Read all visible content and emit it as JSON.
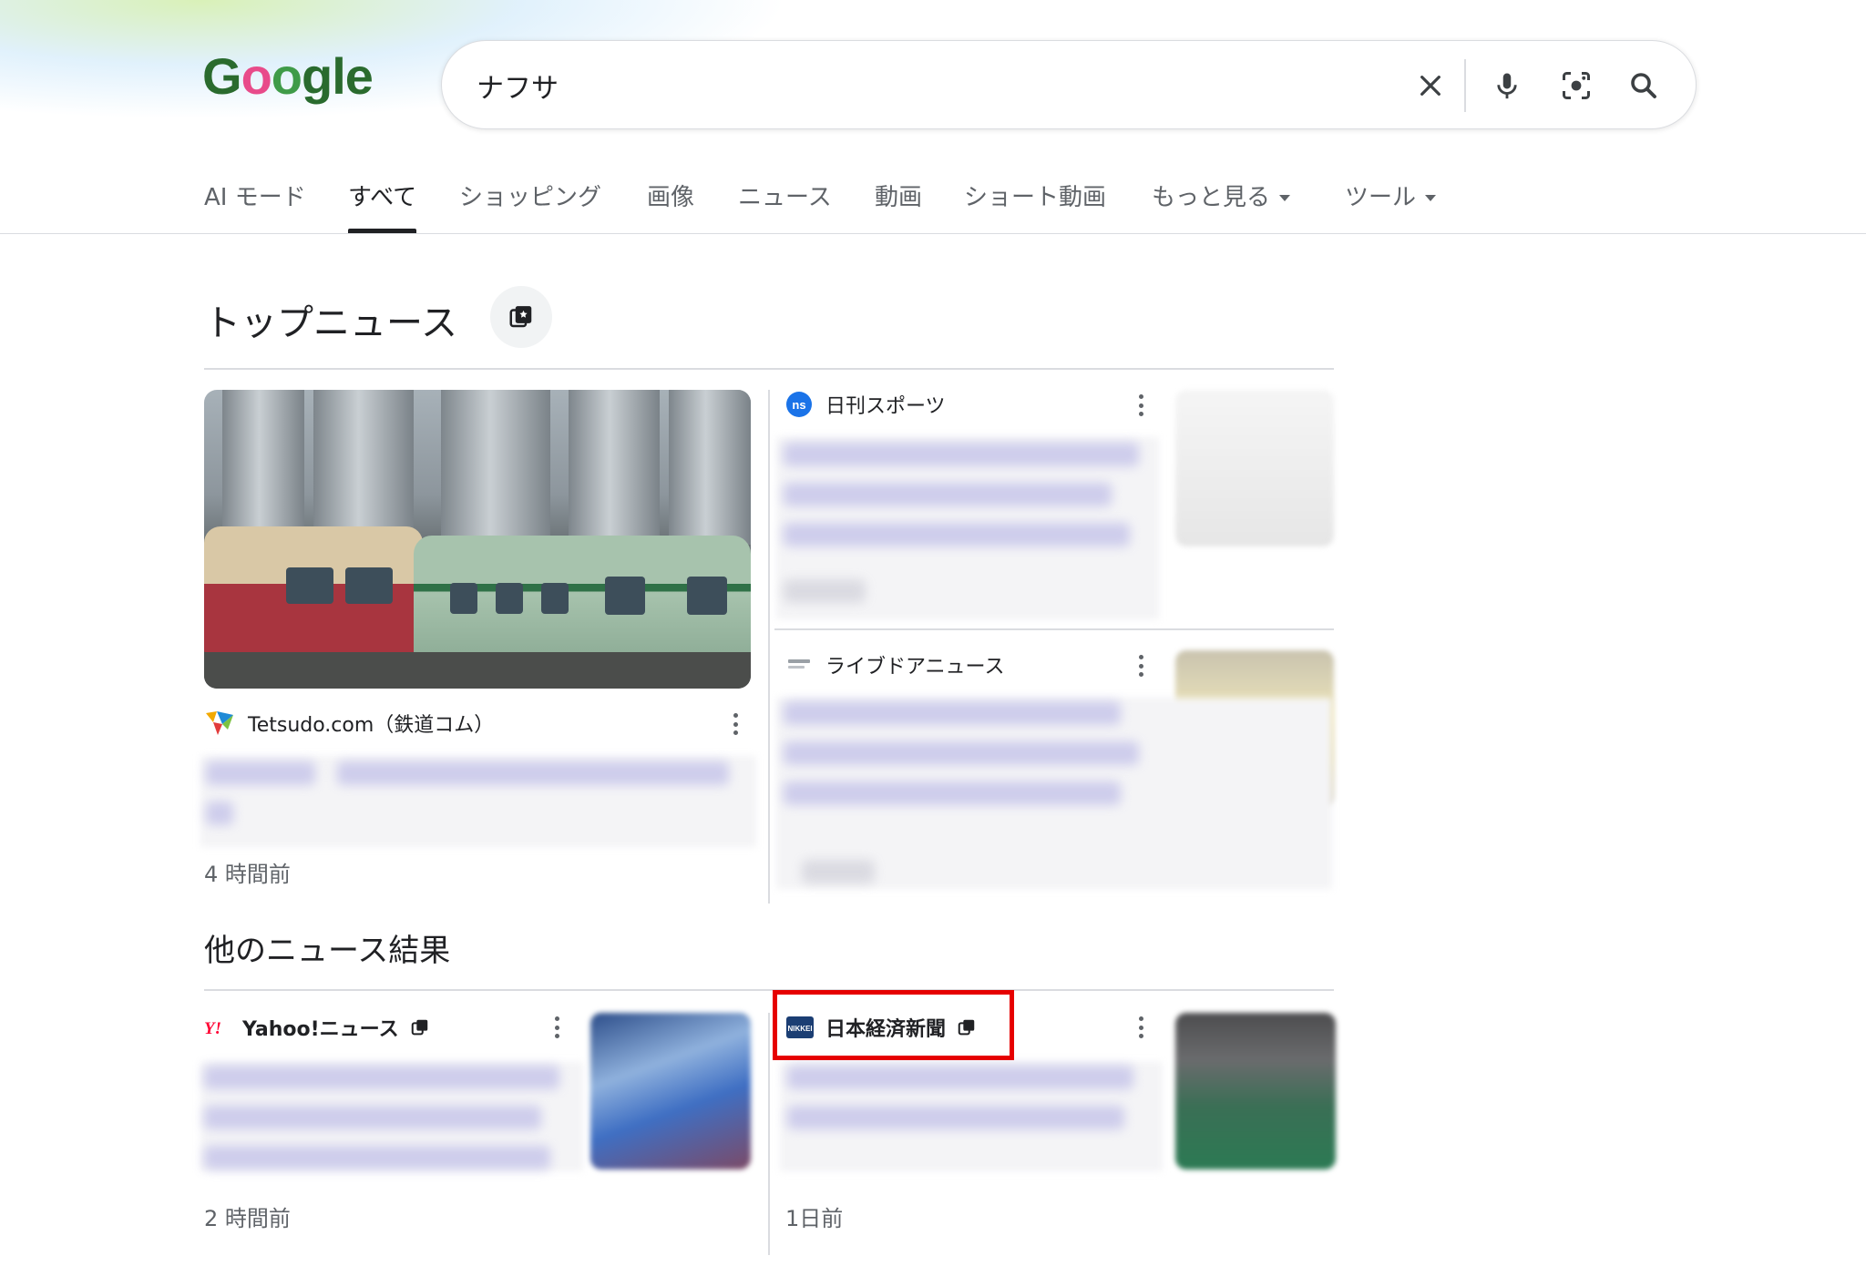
{
  "search": {
    "query": "ナフサ",
    "clear_label": "×"
  },
  "logo": {
    "text": "Google"
  },
  "tabs": [
    {
      "label": "AI モード"
    },
    {
      "label": "すべて"
    },
    {
      "label": "ショッピング"
    },
    {
      "label": "画像"
    },
    {
      "label": "ニュース"
    },
    {
      "label": "動画"
    },
    {
      "label": "ショート動画"
    },
    {
      "label": "もっと見る"
    },
    {
      "label": "ツール"
    }
  ],
  "top_news": {
    "title": "トップニュース",
    "main_story": {
      "source": "Tetsudo.com（鉄道コム）",
      "time": "4 時間前"
    },
    "side_stories": [
      {
        "source": "日刊スポーツ"
      },
      {
        "source": "ライブドアニュース"
      }
    ]
  },
  "other_news": {
    "title": "他のニュース結果",
    "items": [
      {
        "source": "Yahoo!ニュース",
        "time": "2 時間前"
      },
      {
        "source": "日本経済新聞",
        "time": "1日前"
      }
    ]
  },
  "icons": {
    "clear": "close-icon",
    "voice": "microphone-icon",
    "lens": "camera-lens-icon",
    "search": "search-icon",
    "stack": "stacked-pages-icon"
  },
  "colors": {
    "highlight": "#e60000",
    "nikkansports_badge": "#1a73e8",
    "yahoo_red": "#ff0033",
    "nikkei_blue": "#1b3e73"
  }
}
